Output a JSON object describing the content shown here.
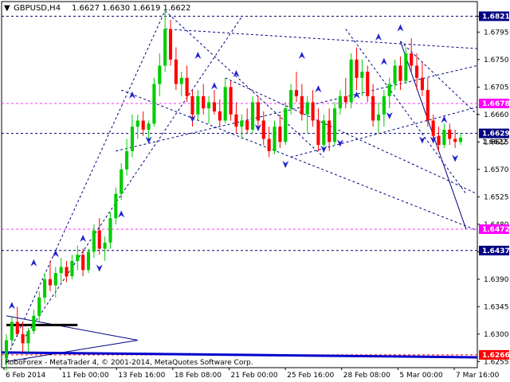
{
  "header": {
    "symbol": "GBPUSD,H4",
    "ohlc": "1.6627 1.6630 1.6619 1.6622",
    "dropdown_glyph": "▼"
  },
  "watermark": "RoboForex - MetaTrader 4, © 2001-2014, MetaQuotes Software Corp.",
  "colors": {
    "bull": "#00cc00",
    "bear": "#ff0000",
    "level_magenta": "#ff33ff",
    "level_navy": "#000066",
    "trend_navy": "#000080",
    "arrow_blue": "#2222cc",
    "price_tag_bg": "#000080",
    "magenta_tag_bg": "#ff00ff",
    "red_tag_bg": "#ff0000"
  },
  "chart_data": {
    "type": "candlestick",
    "ylim": [
      1.6245,
      1.6845
    ],
    "y_ticks": [
      "1.6821",
      "1.6795",
      "1.6750",
      "1.6705",
      "1.6660",
      "1.6615",
      "1.6570",
      "1.6525",
      "1.6480",
      "1.6435",
      "1.6390",
      "1.6345",
      "1.6300",
      "1.6255"
    ],
    "x_ticks": [
      "6 Feb 2014",
      "11 Feb 00:00",
      "13 Feb 16:00",
      "18 Feb 08:00",
      "21 Feb 00:00",
      "25 Feb 16:00",
      "28 Feb 08:00",
      "5 Mar 00:00",
      "7 Mar 16:00"
    ],
    "levels": [
      {
        "value": 1.6821,
        "label": "1.6821",
        "style": "navy"
      },
      {
        "value": 1.6678,
        "label": "1.6678",
        "style": "magenta"
      },
      {
        "value": 1.6629,
        "label": "1.6629",
        "style": "navy"
      },
      {
        "value": 1.6472,
        "label": "1.6472",
        "style": "magenta"
      },
      {
        "value": 1.6437,
        "label": "1.6437",
        "style": "navy"
      },
      {
        "value": 1.6266,
        "label": "1.6266",
        "style": "red"
      }
    ],
    "price_tags": [
      {
        "value": 1.6622,
        "label": "1.6622"
      }
    ],
    "candles": [
      [
        1.626,
        1.63,
        1.624,
        1.629
      ],
      [
        1.629,
        1.633,
        1.628,
        1.632
      ],
      [
        1.632,
        1.6345,
        1.6295,
        1.63
      ],
      [
        1.63,
        1.632,
        1.627,
        1.6285
      ],
      [
        1.6285,
        1.631,
        1.627,
        1.6305
      ],
      [
        1.6305,
        1.634,
        1.63,
        1.633
      ],
      [
        1.633,
        1.637,
        1.632,
        1.636
      ],
      [
        1.636,
        1.64,
        1.635,
        1.639
      ],
      [
        1.639,
        1.642,
        1.637,
        1.638
      ],
      [
        1.638,
        1.641,
        1.636,
        1.64
      ],
      [
        1.64,
        1.6425,
        1.6385,
        1.641
      ],
      [
        1.641,
        1.642,
        1.6385,
        1.6395
      ],
      [
        1.6395,
        1.643,
        1.639,
        1.642
      ],
      [
        1.642,
        1.6445,
        1.6405,
        1.643
      ],
      [
        1.643,
        1.644,
        1.6395,
        1.6405
      ],
      [
        1.6405,
        1.644,
        1.64,
        1.6435
      ],
      [
        1.6435,
        1.648,
        1.6425,
        1.647
      ],
      [
        1.647,
        1.649,
        1.643,
        1.644
      ],
      [
        1.644,
        1.646,
        1.642,
        1.645
      ],
      [
        1.645,
        1.65,
        1.644,
        1.649
      ],
      [
        1.649,
        1.654,
        1.648,
        1.653
      ],
      [
        1.653,
        1.658,
        1.652,
        1.657
      ],
      [
        1.657,
        1.662,
        1.656,
        1.66
      ],
      [
        1.66,
        1.666,
        1.659,
        1.664
      ],
      [
        1.664,
        1.666,
        1.662,
        1.665
      ],
      [
        1.665,
        1.6665,
        1.6625,
        1.6635
      ],
      [
        1.6635,
        1.665,
        1.6615,
        1.6645
      ],
      [
        1.6645,
        1.672,
        1.664,
        1.671
      ],
      [
        1.671,
        1.676,
        1.669,
        1.674
      ],
      [
        1.674,
        1.683,
        1.673,
        1.68
      ],
      [
        1.68,
        1.6815,
        1.674,
        1.675
      ],
      [
        1.675,
        1.677,
        1.67,
        1.671
      ],
      [
        1.671,
        1.673,
        1.669,
        1.672
      ],
      [
        1.672,
        1.674,
        1.668,
        1.669
      ],
      [
        1.669,
        1.67,
        1.664,
        1.666
      ],
      [
        1.666,
        1.67,
        1.665,
        1.669
      ],
      [
        1.669,
        1.671,
        1.666,
        1.667
      ],
      [
        1.667,
        1.669,
        1.6645,
        1.668
      ],
      [
        1.668,
        1.67,
        1.666,
        1.6665
      ],
      [
        1.6665,
        1.6685,
        1.664,
        1.665
      ],
      [
        1.665,
        1.672,
        1.6645,
        1.6705
      ],
      [
        1.6705,
        1.6715,
        1.665,
        1.666
      ],
      [
        1.666,
        1.668,
        1.663,
        1.664
      ],
      [
        1.664,
        1.666,
        1.662,
        1.665
      ],
      [
        1.665,
        1.667,
        1.663,
        1.6635
      ],
      [
        1.6635,
        1.669,
        1.663,
        1.668
      ],
      [
        1.668,
        1.669,
        1.664,
        1.665
      ],
      [
        1.665,
        1.6665,
        1.661,
        1.662
      ],
      [
        1.662,
        1.664,
        1.659,
        1.66
      ],
      [
        1.66,
        1.665,
        1.6595,
        1.664
      ],
      [
        1.664,
        1.666,
        1.6605,
        1.6615
      ],
      [
        1.6615,
        1.668,
        1.661,
        1.667
      ],
      [
        1.667,
        1.671,
        1.666,
        1.67
      ],
      [
        1.67,
        1.673,
        1.668,
        1.669
      ],
      [
        1.669,
        1.671,
        1.665,
        1.666
      ],
      [
        1.666,
        1.669,
        1.663,
        1.668
      ],
      [
        1.668,
        1.67,
        1.664,
        1.665
      ],
      [
        1.665,
        1.667,
        1.66,
        1.661
      ],
      [
        1.661,
        1.666,
        1.6605,
        1.665
      ],
      [
        1.665,
        1.667,
        1.66,
        1.6615
      ],
      [
        1.6615,
        1.668,
        1.661,
        1.667
      ],
      [
        1.667,
        1.67,
        1.666,
        1.669
      ],
      [
        1.669,
        1.672,
        1.667,
        1.668
      ],
      [
        1.668,
        1.676,
        1.667,
        1.675
      ],
      [
        1.675,
        1.677,
        1.67,
        1.672
      ],
      [
        1.672,
        1.675,
        1.669,
        1.673
      ],
      [
        1.673,
        1.674,
        1.668,
        1.669
      ],
      [
        1.669,
        1.671,
        1.664,
        1.665
      ],
      [
        1.665,
        1.668,
        1.663,
        1.666
      ],
      [
        1.666,
        1.67,
        1.664,
        1.669
      ],
      [
        1.669,
        1.672,
        1.667,
        1.671
      ],
      [
        1.671,
        1.675,
        1.67,
        1.674
      ],
      [
        1.674,
        1.6755,
        1.67,
        1.6715
      ],
      [
        1.6715,
        1.677,
        1.671,
        1.676
      ],
      [
        1.676,
        1.6785,
        1.673,
        1.674
      ],
      [
        1.674,
        1.676,
        1.67,
        1.672
      ],
      [
        1.672,
        1.6745,
        1.669,
        1.67
      ],
      [
        1.67,
        1.672,
        1.664,
        1.665
      ],
      [
        1.665,
        1.666,
        1.6615,
        1.6625
      ],
      [
        1.6625,
        1.664,
        1.66,
        1.661
      ],
      [
        1.661,
        1.6645,
        1.6605,
        1.6635
      ],
      [
        1.6635,
        1.6645,
        1.661,
        1.662
      ],
      [
        1.662,
        1.6635,
        1.6605,
        1.6615
      ],
      [
        1.6615,
        1.663,
        1.661,
        1.6622
      ]
    ],
    "trend_lines": [
      {
        "from": [
          0,
          1.626
        ],
        "to": [
          29,
          1.683
        ],
        "dashed": true
      },
      {
        "from": [
          3,
          1.629
        ],
        "to": [
          43,
          1.682
        ],
        "dashed": true
      },
      {
        "from": [
          29,
          1.683
        ],
        "to": [
          58,
          1.659
        ],
        "dashed": true
      },
      {
        "from": [
          29,
          1.68
        ],
        "to": [
          86,
          1.6768
        ],
        "dashed": true
      },
      {
        "from": [
          21,
          1.67
        ],
        "to": [
          86,
          1.647
        ],
        "dashed": true
      },
      {
        "from": [
          52,
          1.659
        ],
        "to": [
          86,
          1.6672
        ],
        "dashed": true
      },
      {
        "from": [
          40,
          1.672
        ],
        "to": [
          86,
          1.653
        ],
        "dashed": true
      },
      {
        "from": [
          20,
          1.66
        ],
        "to": [
          86,
          1.674
        ],
        "dashed": true
      },
      {
        "from": [
          72,
          1.678
        ],
        "to": [
          86,
          1.666
        ],
        "dashed": true
      },
      {
        "from": [
          62,
          1.68
        ],
        "to": [
          84,
          1.653
        ],
        "dashed": true
      },
      {
        "from": [
          72,
          1.678
        ],
        "to": [
          84,
          1.6472
        ],
        "dashed": false
      }
    ],
    "arrows": [
      {
        "i": 1,
        "v": 1.6345,
        "dir": "up"
      },
      {
        "i": 5,
        "v": 1.6415,
        "dir": "up"
      },
      {
        "i": 9,
        "v": 1.643,
        "dir": "up"
      },
      {
        "i": 14,
        "v": 1.6455,
        "dir": "up"
      },
      {
        "i": 17,
        "v": 1.641,
        "dir": "down"
      },
      {
        "i": 21,
        "v": 1.6495,
        "dir": "up"
      },
      {
        "i": 23,
        "v": 1.669,
        "dir": "up"
      },
      {
        "i": 26,
        "v": 1.662,
        "dir": "down"
      },
      {
        "i": 35,
        "v": 1.6755,
        "dir": "up"
      },
      {
        "i": 34,
        "v": 1.6655,
        "dir": "down"
      },
      {
        "i": 38,
        "v": 1.6705,
        "dir": "up"
      },
      {
        "i": 42,
        "v": 1.6725,
        "dir": "up"
      },
      {
        "i": 46,
        "v": 1.664,
        "dir": "down"
      },
      {
        "i": 51,
        "v": 1.658,
        "dir": "down"
      },
      {
        "i": 54,
        "v": 1.6755,
        "dir": "up"
      },
      {
        "i": 57,
        "v": 1.67,
        "dir": "up"
      },
      {
        "i": 58,
        "v": 1.6605,
        "dir": "down"
      },
      {
        "i": 64,
        "v": 1.669,
        "dir": "up"
      },
      {
        "i": 61,
        "v": 1.6615,
        "dir": "down"
      },
      {
        "i": 68,
        "v": 1.6785,
        "dir": "up"
      },
      {
        "i": 69,
        "v": 1.6745,
        "dir": "up"
      },
      {
        "i": 72,
        "v": 1.68,
        "dir": "up"
      },
      {
        "i": 70,
        "v": 1.666,
        "dir": "down"
      },
      {
        "i": 76,
        "v": 1.662,
        "dir": "down"
      },
      {
        "i": 80,
        "v": 1.665,
        "dir": "up"
      },
      {
        "i": 82,
        "v": 1.659,
        "dir": "down"
      },
      {
        "i": 78,
        "v": 1.662,
        "dir": "down"
      }
    ],
    "black_bar": {
      "from": [
        0,
        1.6315
      ],
      "to": [
        13,
        1.6315
      ]
    },
    "blue_bar": {
      "from": [
        0,
        1.627
      ],
      "to": [
        86,
        1.6262
      ]
    },
    "channel_triangle": [
      [
        0,
        1.633
      ],
      [
        24,
        1.629
      ],
      [
        0,
        1.6255
      ]
    ]
  }
}
